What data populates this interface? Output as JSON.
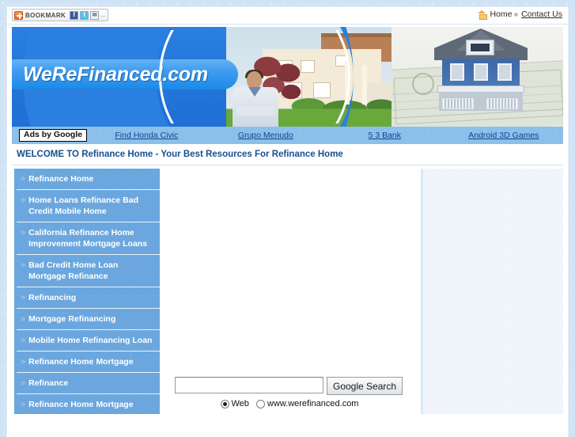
{
  "topbar": {
    "bookmark": {
      "label": "BOOKMARK",
      "plus_icon": "plus-icon",
      "share_icons": [
        {
          "name": "facebook-icon",
          "glyph": "f"
        },
        {
          "name": "twitter-icon",
          "glyph": "t"
        },
        {
          "name": "email-icon",
          "glyph": "✉"
        }
      ],
      "more": "..."
    },
    "nav": {
      "home_icon": "home-icon",
      "home_label": "Home",
      "separator": "»",
      "contact_label": "Contact Us"
    }
  },
  "banner": {
    "logo_text": "WeReFinanced.com",
    "images": [
      {
        "name": "house-family-photo",
        "alt": "Two-story house with family and man in foreground"
      },
      {
        "name": "house-on-money-photo",
        "alt": "Blue model house resting on stack of dollar bills"
      }
    ]
  },
  "ads": {
    "label": "Ads by Google",
    "links": [
      "Find Honda Civic",
      "Grupo Menudo",
      "5 3 Bank",
      "Android 3D Games"
    ]
  },
  "welcome": {
    "headline": "WELCOME TO Refinance Home - Your Best Resources For Refinance Home"
  },
  "sidebar": {
    "bullet": "»",
    "items": [
      {
        "label": "Refinance Home"
      },
      {
        "label": "Home Loans Refinance Bad Credit Mobile Home"
      },
      {
        "label": "California Refinance Home Improvement Mortgage Loans"
      },
      {
        "label": "Bad Credit Home Loan Mortgage Refinance"
      },
      {
        "label": "Refinancing"
      },
      {
        "label": "Mortgage Refinancing"
      },
      {
        "label": "Mobile Home Refinancing Loan"
      },
      {
        "label": "Refinance Home Mortgage"
      },
      {
        "label": "Refinance"
      },
      {
        "label": "Refinance Home Mortgage"
      }
    ]
  },
  "search": {
    "input_value": "",
    "placeholder": "",
    "button_label": "Google Search",
    "scope_options": [
      {
        "label": "Web",
        "selected": true
      },
      {
        "label": "www.werefinanced.com",
        "selected": false
      }
    ]
  },
  "colors": {
    "page_background": "#cfe3f7",
    "banner_blue": "#2a7fe0",
    "logo_pill_blue": "#3f9cef",
    "sidebar_blue": "#6ba7de",
    "ads_bar_blue": "#8cc0ea",
    "headline_blue": "#17508f",
    "ad_link_blue": "#13428f",
    "right_rail": "#f0f5fb"
  }
}
